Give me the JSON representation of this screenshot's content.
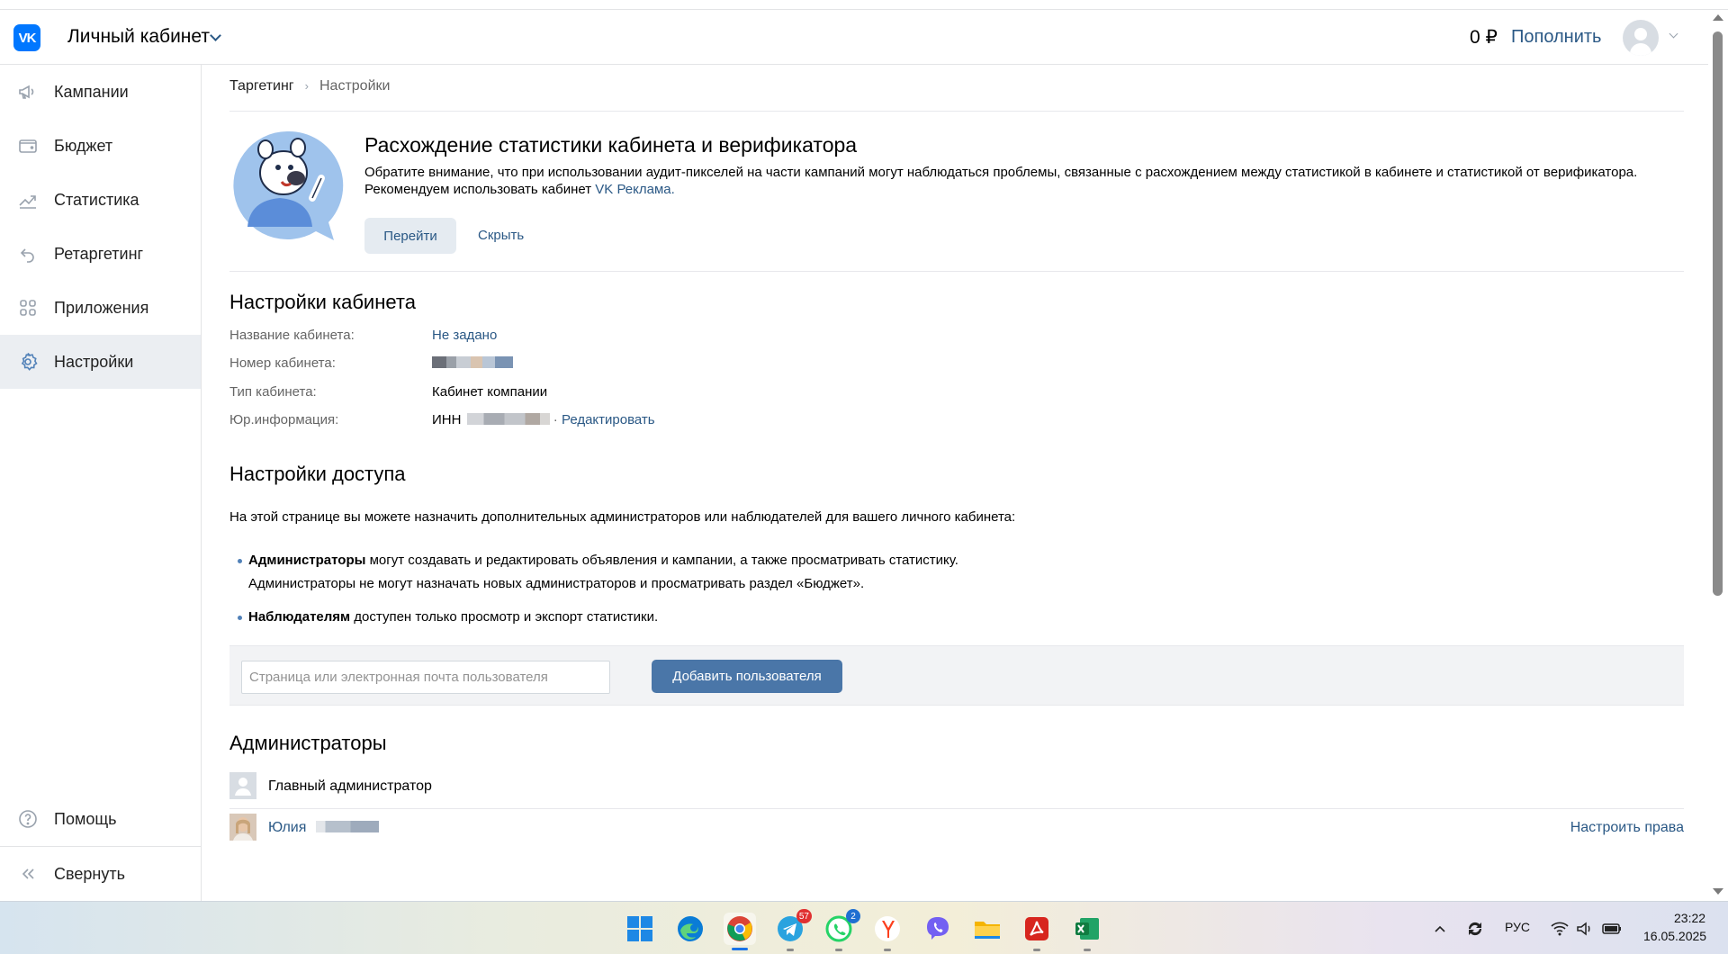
{
  "header": {
    "title": "Личный кабинет",
    "balance": "0 ₽",
    "topup_label": "Пополнить"
  },
  "sidebar": {
    "items": [
      {
        "label": "Кампании",
        "icon": "megaphone-icon"
      },
      {
        "label": "Бюджет",
        "icon": "wallet-icon"
      },
      {
        "label": "Статистика",
        "icon": "chart-line-icon"
      },
      {
        "label": "Ретаргетинг",
        "icon": "undo-arrow-icon"
      },
      {
        "label": "Приложения",
        "icon": "apps-grid-icon"
      },
      {
        "label": "Настройки",
        "icon": "gear-icon",
        "active": true
      }
    ],
    "help_label": "Помощь",
    "collapse_label": "Свернуть"
  },
  "breadcrumb": {
    "root": "Таргетинг",
    "sep": "›",
    "current": "Настройки"
  },
  "banner": {
    "title": "Расхождение статистики кабинета и верификатора",
    "text_before": "Обратите внимание, что при использовании аудит-пикселей на части кампаний могут наблюдаться проблемы, связанные с расхождением между статистикой в кабинете и статистикой от верификатора. Рекомендуем использовать кабинет ",
    "link": "VK Реклама",
    "text_after": ".",
    "go_label": "Перейти",
    "hide_label": "Скрыть"
  },
  "cabinet_settings": {
    "title": "Настройки кабинета",
    "name_label": "Название кабинета:",
    "name_value": "Не задано",
    "number_label": "Номер кабинета:",
    "type_label": "Тип кабинета:",
    "type_value": "Кабинет компании",
    "legal_label": "Юр.информация:",
    "legal_prefix": "ИНН",
    "legal_sep": "·",
    "edit_label": "Редактировать"
  },
  "access": {
    "title": "Настройки доступа",
    "intro": "На этой странице вы можете назначить дополнительных администраторов или наблюдателей для вашего личного кабинета:",
    "admins_bold": "Администраторы",
    "admins_text": " могут создавать и редактировать объявления и кампании, а также просматривать статистику.",
    "admins_text2": "Администраторы не могут назначать новых администраторов и просматривать раздел «Бюджет».",
    "observers_bold": "Наблюдателям",
    "observers_text": " доступен только просмотр и экспорт статистики.",
    "input_placeholder": "Страница или электронная почта пользователя",
    "add_button": "Добавить пользователя"
  },
  "admins": {
    "title": "Администраторы",
    "rows": [
      {
        "name": "Главный администратор"
      },
      {
        "name": "Юлия",
        "action": "Настроить права"
      }
    ]
  },
  "taskbar": {
    "apps": [
      {
        "name": "windows-start-icon"
      },
      {
        "name": "edge-icon"
      },
      {
        "name": "chrome-icon"
      },
      {
        "name": "telegram-icon",
        "badge": "57"
      },
      {
        "name": "whatsapp-icon",
        "badge": "2"
      },
      {
        "name": "yandex-browser-icon"
      },
      {
        "name": "viber-icon"
      },
      {
        "name": "file-explorer-icon"
      },
      {
        "name": "acrobat-icon"
      },
      {
        "name": "excel-icon"
      }
    ],
    "lang": "РУС",
    "time": "23:22",
    "date": "16.05.2025"
  },
  "colors": {
    "link": "#2a5885",
    "accent_button": "#4a76a8",
    "vk_brand": "#0077ff",
    "active_nav_bg": "#ebeef2"
  }
}
